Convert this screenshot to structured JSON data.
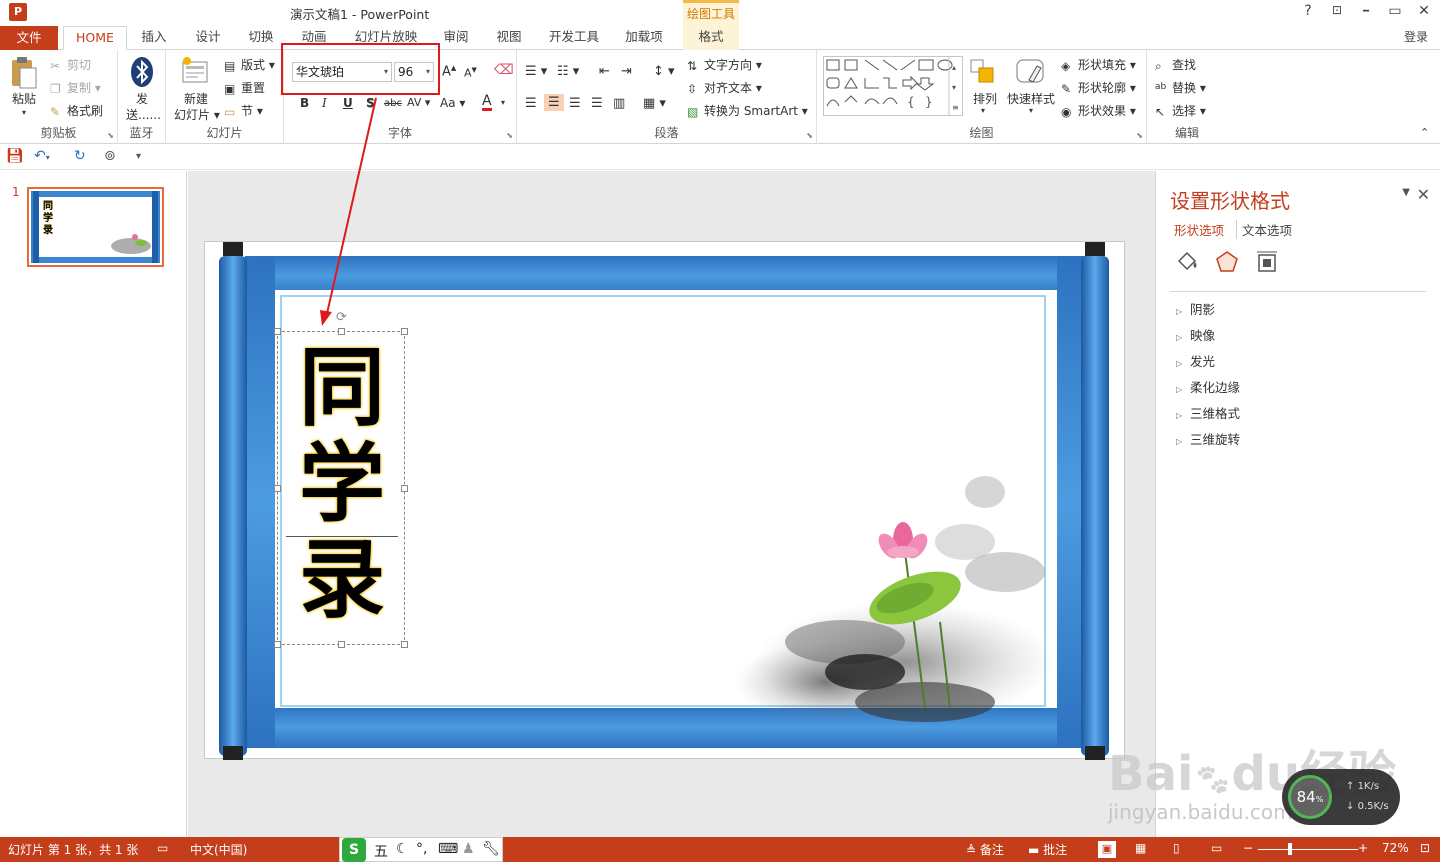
{
  "titlebar": {
    "app_icon": "P",
    "title": "演示文稿1 - PowerPoint",
    "context_tool": "绘图工具",
    "help": "?",
    "restore_ribbon": "⊡",
    "minimize": "━",
    "maximize": "▭",
    "close": "✕"
  },
  "tabs": {
    "file": "文件",
    "items": [
      "HOME",
      "插入",
      "设计",
      "切换",
      "动画",
      "幻灯片放映",
      "审阅",
      "视图",
      "开发工具",
      "加载项",
      "格式"
    ],
    "login": "登录"
  },
  "ribbon": {
    "clipboard": {
      "label": "剪贴板",
      "paste": "粘贴",
      "cut": "剪切",
      "copy": "复制",
      "format_painter": "格式刷"
    },
    "bluetooth": {
      "label": "蓝牙",
      "send1": "发",
      "send2": "送......"
    },
    "slides": {
      "label": "幻灯片",
      "new_slide1": "新建",
      "new_slide2": "幻灯片",
      "layout": "版式",
      "reset": "重置",
      "section": "节"
    },
    "font": {
      "label": "字体",
      "font_name": "华文琥珀",
      "font_size": "96",
      "bold": "B",
      "italic": "I",
      "underline": "U",
      "shadow": "S",
      "strike": "abc",
      "spacing": "AV",
      "case": "Aa",
      "color": "A",
      "grow": "A",
      "shrink": "A"
    },
    "paragraph": {
      "label": "段落",
      "text_direction": "文字方向",
      "align_text": "对齐文本",
      "smartart": "转换为 SmartArt"
    },
    "drawing": {
      "label": "绘图",
      "arrange": "排列",
      "quick_styles": "快速样式",
      "shape_fill": "形状填充",
      "shape_outline": "形状轮廓",
      "shape_effects": "形状效果"
    },
    "editing": {
      "label": "编辑",
      "find": "查找",
      "replace": "替换",
      "select": "选择"
    }
  },
  "thumbnails": {
    "number": "1",
    "title_chars": [
      "同",
      "学",
      "录"
    ]
  },
  "slide": {
    "title_chars": [
      "同",
      "学",
      "录"
    ]
  },
  "pane": {
    "title": "设置形状格式",
    "tab_shape": "形状选项",
    "tab_text": "文本选项",
    "items": [
      "阴影",
      "映像",
      "发光",
      "柔化边缘",
      "三维格式",
      "三维旋转"
    ]
  },
  "statusbar": {
    "slide_info": "幻灯片 第 1 张，共 1 张",
    "language": "中文(中国)",
    "ime_logo": "S",
    "ime_wubi": "五",
    "notes": "备注",
    "comments": "批注",
    "zoom": "72%"
  },
  "widget": {
    "percent": "84",
    "percent_sign": "%",
    "up": "1K/s",
    "down": "0.5K/s"
  },
  "watermark": {
    "line1": "Bai",
    "line1b": "du",
    "line1c": "经验",
    "line2": "jingyan.baidu.com"
  },
  "colors": {
    "accent": "#c43e1c",
    "highlight_box": "#e0191a",
    "scroll_blue": "#2f7fce",
    "format_context": "#d27800"
  }
}
